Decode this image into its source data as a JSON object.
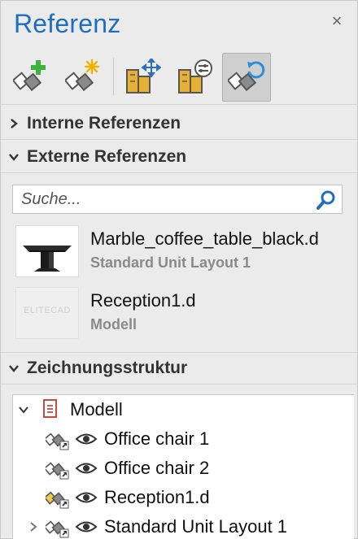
{
  "panel": {
    "title": "Referenz",
    "close_glyph": "×"
  },
  "toolbar": {
    "buttons": [
      {
        "name": "add-reference",
        "icon": "blocks-plus-icon"
      },
      {
        "name": "new-reference",
        "icon": "blocks-star-icon"
      },
      {
        "name": "move-reference",
        "icon": "building-move-icon"
      },
      {
        "name": "reference-settings",
        "icon": "building-settings-icon"
      },
      {
        "name": "reload-reference",
        "icon": "blocks-reload-icon",
        "active": true
      }
    ]
  },
  "sections": {
    "internal": {
      "label": "Interne Referenzen",
      "expanded": false
    },
    "external": {
      "label": "Externe Referenzen",
      "expanded": true
    },
    "structure": {
      "label": "Zeichnungsstruktur",
      "expanded": true
    }
  },
  "search": {
    "placeholder": "Suche..."
  },
  "external_refs": [
    {
      "name": "Marble_coffee_table_black.d",
      "layout": "Standard Unit Layout 1"
    },
    {
      "name": "Reception1.d",
      "layout": "Modell",
      "thumb_text": "ELITECAD"
    }
  ],
  "tree": {
    "root": {
      "label": "Modell"
    },
    "items": [
      {
        "label": "Office chair 1"
      },
      {
        "label": "Office chair 2"
      },
      {
        "label": "Reception1.d"
      },
      {
        "label": "Standard Unit Layout 1"
      }
    ]
  },
  "colors": {
    "accent": "#1f6fc1",
    "icon_dark": "#555555",
    "icon_plus": "#3db33d",
    "icon_star": "#f0b400",
    "icon_building": "#e8b032",
    "icon_reload": "#2a8fd6"
  }
}
